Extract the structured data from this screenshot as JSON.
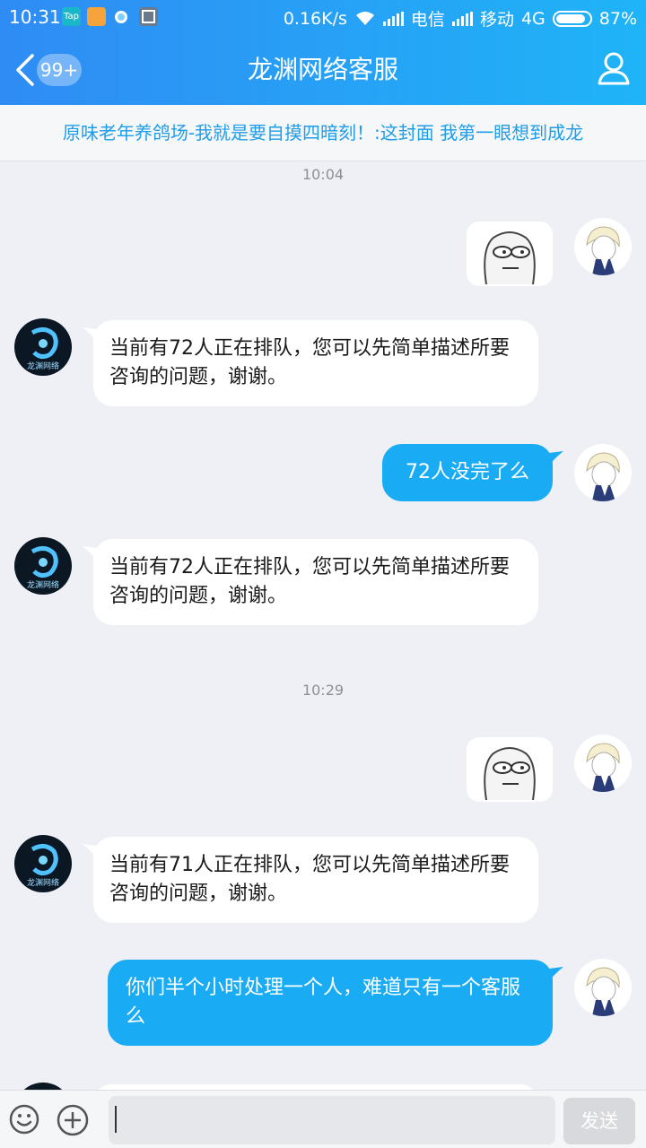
{
  "status_bar": {
    "time": "10:31",
    "speed": "0.16K/s",
    "carrier1": "电信",
    "carrier2": "移动",
    "network": "4G",
    "battery": "87%"
  },
  "header": {
    "badge": "99+",
    "title": "龙渊网络客服"
  },
  "notice": "原味老年养鸽场-我就是要自摸四暗刻！:这封面 我第一眼想到成龙",
  "chat": {
    "time1": "10:04",
    "time2": "10:29",
    "msg1": "当前有72人正在排队，您可以先简单描述所要咨询的问题，谢谢。",
    "msg2": "72人没完了么",
    "msg3": "当前有72人正在排队，您可以先简单描述所要咨询的问题，谢谢。",
    "msg4": "当前有71人正在排队，您可以先简单描述所要咨询的问题，谢谢。",
    "msg5": "你们半个小时处理一个人，难道只有一个客服么",
    "bot_logo_text": "龙渊网络"
  },
  "input_bar": {
    "send_label": "发送"
  },
  "colors": {
    "header_start": "#2f8cf4",
    "header_end": "#1fb4f7",
    "outgoing_bubble": "#19acf4",
    "notice_text": "#1f9de8"
  }
}
